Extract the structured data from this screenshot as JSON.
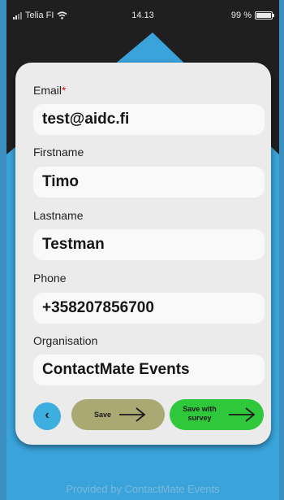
{
  "status_bar": {
    "carrier": "Telia FI",
    "time": "14.13",
    "battery": "99 %"
  },
  "form": {
    "email_label": "Email",
    "email_required_mark": "*",
    "email_value": "test@aidc.fi",
    "firstname_label": "Firstname",
    "firstname_value": "Timo",
    "lastname_label": "Lastname",
    "lastname_value": "Testman",
    "phone_label": "Phone",
    "phone_value": "+358207856700",
    "organisation_label": "Organisation",
    "organisation_value": "ContactMate Events"
  },
  "buttons": {
    "back_icon": "chevron-left-icon",
    "save_label": "Save",
    "save_survey_line1": "Save with",
    "save_survey_line2": "survey"
  },
  "footer": {
    "text": "Provided by ContactMate Events"
  },
  "colors": {
    "background_blue": "#3aa4da",
    "card": "#ebebeb",
    "field": "#f9f9f9",
    "back_button": "#3eaee0",
    "save_button": "#aaa973",
    "survey_button": "#2ec83a",
    "required": "#d21c1c"
  }
}
